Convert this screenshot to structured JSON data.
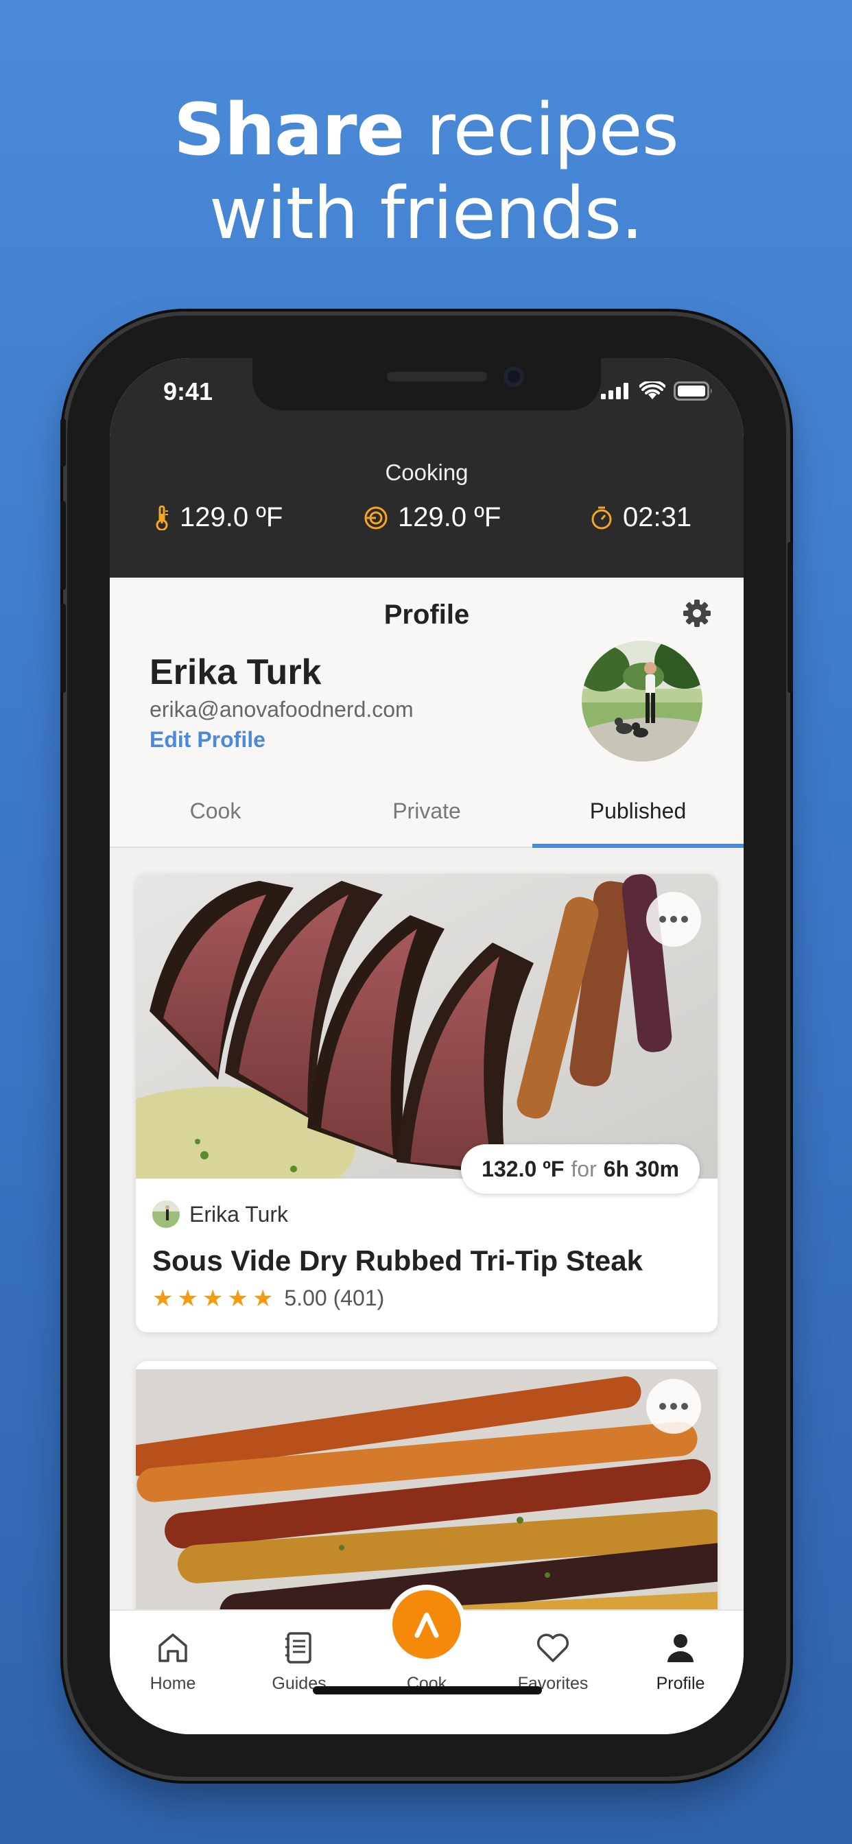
{
  "headline": {
    "bold": "Share",
    "rest1": " recipes",
    "line2": "with friends."
  },
  "status_bar": {
    "time": "9:41"
  },
  "cooking": {
    "label": "Cooking",
    "water_temp": "129.0 ºF",
    "target_temp": "129.0 ºF",
    "timer": "02:31"
  },
  "header": {
    "title": "Profile"
  },
  "profile": {
    "name": "Erika Turk",
    "email": "erika@anovafoodnerd.com",
    "edit_label": "Edit Profile"
  },
  "tabs": [
    {
      "label": "Cook"
    },
    {
      "label": "Private"
    },
    {
      "label": "Published",
      "active": true
    }
  ],
  "recipes": [
    {
      "temp": "132.0 ºF",
      "for_word": "for",
      "duration": "6h 30m",
      "author": "Erika Turk",
      "title": "Sous Vide Dry Rubbed Tri-Tip Steak",
      "stars": 5,
      "rating": "5.00 (401)"
    },
    {}
  ],
  "tabbar": {
    "home": "Home",
    "guides": "Guides",
    "cook": "Cook",
    "favorites": "Favorites",
    "profile": "Profile"
  },
  "colors": {
    "accent_blue": "#4a8ad8",
    "accent_orange": "#f58a0a",
    "star": "#f39c12",
    "dark_bar": "#2b2b2b"
  }
}
